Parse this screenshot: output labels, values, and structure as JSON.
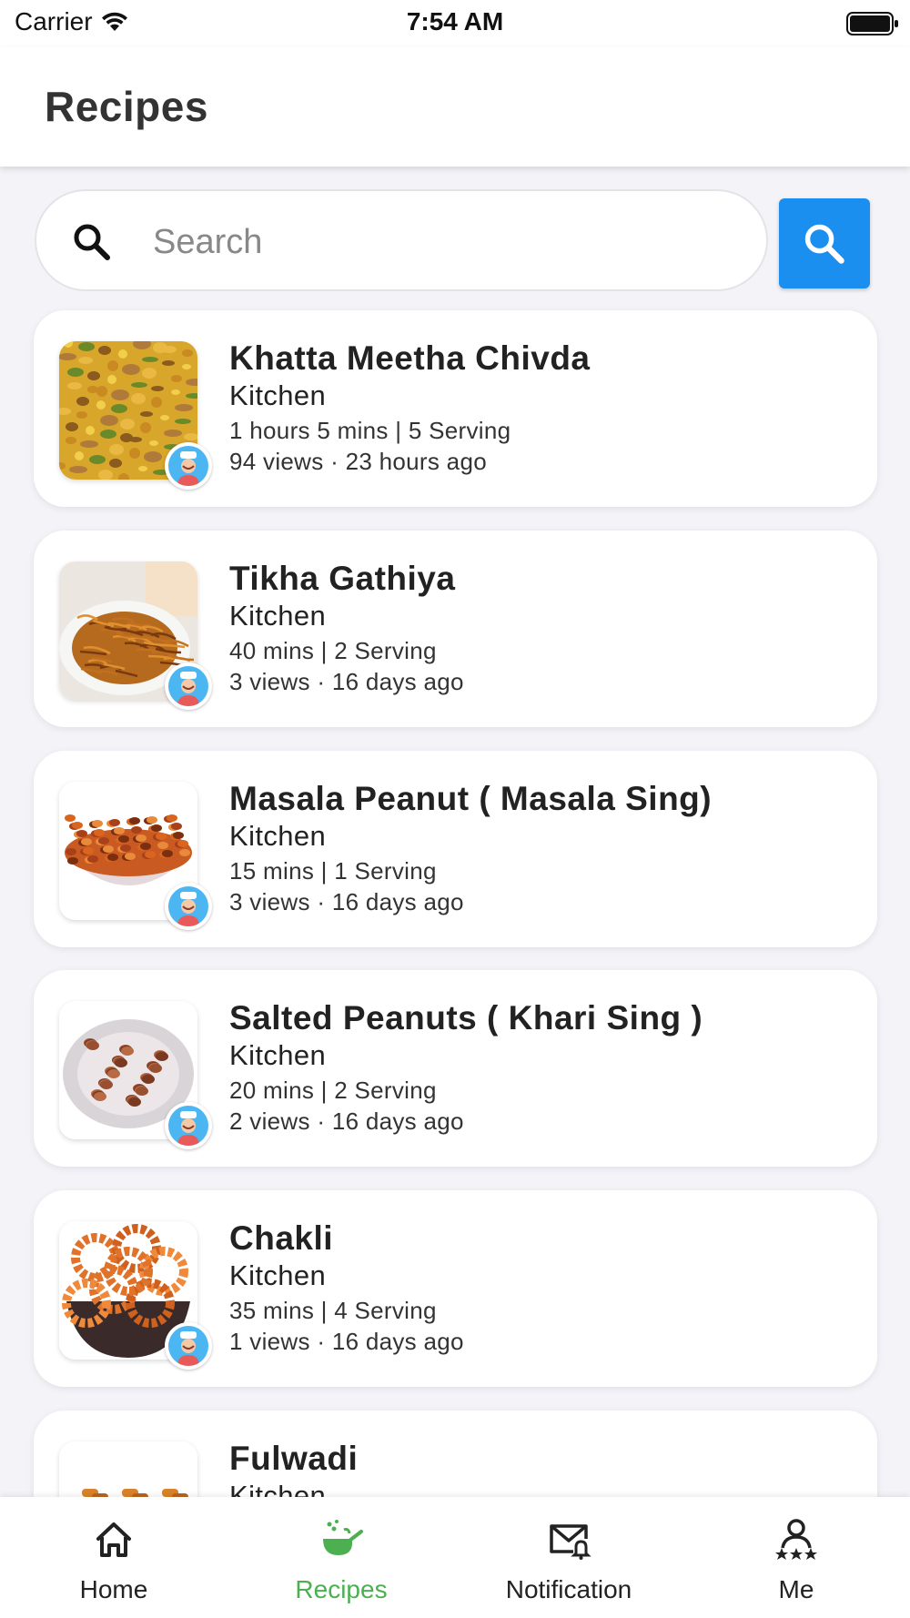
{
  "status_bar": {
    "carrier": "Carrier",
    "time": "7:54 AM"
  },
  "header": {
    "title": "Recipes"
  },
  "search": {
    "placeholder": "Search"
  },
  "recipes": [
    {
      "title": "Khatta Meetha Chivda",
      "author": "Kitchen",
      "time_serving": "1 hours 5 mins | 5 Serving",
      "views": "94 views",
      "age": "23 hours ago",
      "image": "chivda"
    },
    {
      "title": "Tikha Gathiya",
      "author": "Kitchen",
      "time_serving": "40 mins | 2 Serving",
      "views": "3 views",
      "age": "16 days ago",
      "image": "gathiya"
    },
    {
      "title": "Masala Peanut ( Masala Sing)",
      "author": "Kitchen",
      "time_serving": "15 mins | 1 Serving",
      "views": "3 views",
      "age": "16 days ago",
      "image": "masala-peanut"
    },
    {
      "title": "Salted Peanuts ( Khari Sing )",
      "author": "Kitchen",
      "time_serving": "20 mins | 2 Serving",
      "views": "2 views",
      "age": "16 days ago",
      "image": "salted-peanuts"
    },
    {
      "title": "Chakli",
      "author": "Kitchen",
      "time_serving": "35 mins | 4 Serving",
      "views": "1 views",
      "age": "16 days ago",
      "image": "chakli"
    },
    {
      "title": "Fulwadi",
      "author": "Kitchen",
      "time_serving": "",
      "views": "",
      "age": "",
      "image": "fulwadi"
    }
  ],
  "tabs": [
    {
      "label": "Home",
      "icon": "home-icon",
      "active": false
    },
    {
      "label": "Recipes",
      "icon": "cooking-pan-icon",
      "active": true
    },
    {
      "label": "Notification",
      "icon": "mail-bell-icon",
      "active": false
    },
    {
      "label": "Me",
      "icon": "user-stars-icon",
      "active": false
    }
  ],
  "colors": {
    "accent": "#1a8ff0",
    "active_tab": "#4cb050",
    "background": "#f3f3f8"
  }
}
